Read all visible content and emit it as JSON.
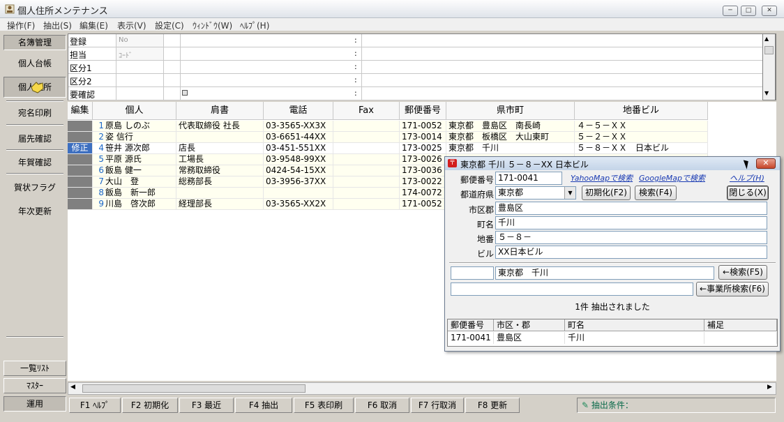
{
  "window": {
    "title": "個人住所メンテナンス",
    "minimize": "─",
    "maximize": "□",
    "close": "✕"
  },
  "menu": [
    "操作(F)",
    "抽出(S)",
    "編集(E)",
    "表示(V)",
    "設定(C)",
    "ｳｨﾝﾄﾞｳ(W)",
    "ﾍﾙﾌﾟ(H)"
  ],
  "sidebar": {
    "top_button": "名簿管理",
    "items": [
      "個人台帳",
      "個人住所",
      "宛名印刷",
      "届先確認",
      "年賀確認",
      "賀状フラグ",
      "年次更新"
    ],
    "bottom_buttons": [
      "一覧ﾘｽﾄ",
      "ﾏｽﾀｰ",
      "運用"
    ]
  },
  "form": {
    "rows": [
      {
        "label": "登録",
        "hint": "No"
      },
      {
        "label": "担当",
        "hint": "ｺｰﾄﾞ"
      },
      {
        "label": "区分1",
        "hint": ""
      },
      {
        "label": "区分2",
        "hint": ""
      },
      {
        "label": "要確認",
        "hint": ""
      }
    ],
    "colon": ":"
  },
  "grid": {
    "headers": [
      "編集",
      "個人",
      "肩書",
      "電話",
      "Fax",
      "郵便番号",
      "県市町",
      "地番ビル"
    ],
    "rows": [
      {
        "edit": "",
        "num": "1",
        "name": "原島 しのぶ",
        "title": "代表取締役 社長",
        "tel": "03-3565-XX3X",
        "fax": "",
        "zip": "171-0052",
        "city": "東京都　豊島区　南長崎",
        "addr": "４－５－ＸＸ"
      },
      {
        "edit": "",
        "num": "2",
        "name": "姿 信行",
        "title": "",
        "tel": "03-6651-44XX",
        "fax": "",
        "zip": "173-0014",
        "city": "東京都　板橋区　大山東町",
        "addr": "５－２－ＸＸ"
      },
      {
        "edit": "修正",
        "num": "4",
        "name": "笹井 源次郎",
        "title": "店長",
        "tel": "03-451-551XX",
        "fax": "",
        "zip": "173-0025",
        "city": "東京都　千川",
        "addr": "５－８－ＸＸ　日本ビル"
      },
      {
        "edit": "",
        "num": "5",
        "name": "平原 源氏",
        "title": "工場長",
        "tel": "03-9548-99XX",
        "fax": "",
        "zip": "173-0026",
        "city": "",
        "addr": ""
      },
      {
        "edit": "",
        "num": "6",
        "name": "飯島 健一",
        "title": "常務取締役",
        "tel": "0424-54-15XX",
        "fax": "",
        "zip": "173-0036",
        "city": "",
        "addr": ""
      },
      {
        "edit": "",
        "num": "7",
        "name": "大山　登",
        "title": "総務部長",
        "tel": "03-3956-37XX",
        "fax": "",
        "zip": "173-0022",
        "city": "",
        "addr": ""
      },
      {
        "edit": "",
        "num": "8",
        "name": "飯島　新一郎",
        "title": "",
        "tel": "",
        "fax": "",
        "zip": "174-0072",
        "city": "",
        "addr": ""
      },
      {
        "edit": "",
        "num": "9",
        "name": "川島　啓次郎",
        "title": "経理部長",
        "tel": "03-3565-XX2X",
        "fax": "",
        "zip": "171-0052",
        "city": "",
        "addr": ""
      }
    ]
  },
  "fkeys": [
    "F1 ﾍﾙﾌﾟ",
    "F2 初期化",
    "F3 最近",
    "F4 抽出",
    "F5 表印刷",
    "F6 取消",
    "F7 行取消",
    "F8 更新"
  ],
  "condition": "抽出条件：",
  "dialog": {
    "title": "東京都  千川  ５－８－XX  日本ビル",
    "close": "✕",
    "labels": {
      "zip": "郵便番号",
      "pref": "都道府県",
      "city": "市区郡",
      "town": "町名",
      "lot": "地番",
      "bldg": "ビル"
    },
    "values": {
      "zip": "171-0041",
      "pref": "東京都",
      "city": "豊島区",
      "town": "千川",
      "lot": "５－８－",
      "bldg": "XX日本ビル"
    },
    "links": {
      "yahoo": "YahooMapで検索",
      "google": "GoogleMapで検索",
      "help": "ヘルプ(H)"
    },
    "buttons": {
      "init": "初期化(F2)",
      "search": "検索(F4)",
      "close": "閉じる(X)",
      "search_f5": "←検索(F5)",
      "office_search": "←事業所検索(F6)"
    },
    "search_field1": "",
    "search_field2": "東京都　千川",
    "office_field": "",
    "result_message": "1件 抽出されました",
    "result_headers": [
      "郵便番号",
      "市区・郡",
      "町名",
      "補足"
    ],
    "result_row": [
      "171-0041",
      "豊島区",
      "千川",
      ""
    ]
  }
}
